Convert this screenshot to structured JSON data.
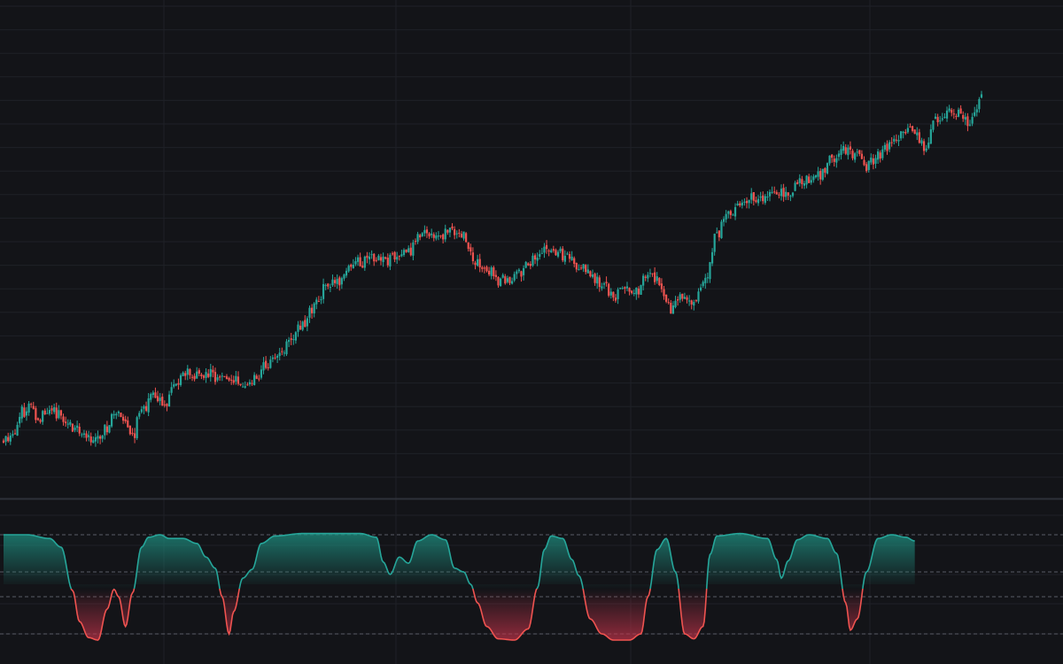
{
  "colors": {
    "background": "#131418",
    "grid": "#1f2127",
    "separator": "#2e3139",
    "up": "#26a69a",
    "down": "#ef5350",
    "up_fill_top": "#1e8c7e",
    "down_fill_bottom": "#c2334a",
    "level_line": "#5a5d66"
  },
  "chart_data": [
    {
      "type": "candlestick",
      "name": "",
      "x": {
        "range": [
          0,
          425
        ]
      },
      "ylim": [
        0,
        212
      ],
      "grid": true,
      "anchors": [
        [
          0,
          12
        ],
        [
          4,
          16
        ],
        [
          8,
          28
        ],
        [
          12,
          32
        ],
        [
          15,
          25
        ],
        [
          20,
          31
        ],
        [
          24,
          26
        ],
        [
          28,
          21
        ],
        [
          34,
          16
        ],
        [
          40,
          11
        ],
        [
          44,
          18
        ],
        [
          48,
          28
        ],
        [
          52,
          22
        ],
        [
          56,
          14
        ],
        [
          60,
          30
        ],
        [
          65,
          36
        ],
        [
          70,
          32
        ],
        [
          75,
          44
        ],
        [
          80,
          52
        ],
        [
          85,
          49
        ],
        [
          90,
          50
        ],
        [
          95,
          47
        ],
        [
          100,
          46
        ],
        [
          105,
          44
        ],
        [
          110,
          50
        ],
        [
          115,
          56
        ],
        [
          120,
          62
        ],
        [
          125,
          73
        ],
        [
          130,
          78
        ],
        [
          135,
          90
        ],
        [
          140,
          100
        ],
        [
          145,
          103
        ],
        [
          150,
          111
        ],
        [
          155,
          115
        ],
        [
          160,
          118
        ],
        [
          165,
          116
        ],
        [
          170,
          117
        ],
        [
          175,
          119
        ],
        [
          180,
          129
        ],
        [
          185,
          132
        ],
        [
          190,
          131
        ],
        [
          195,
          134
        ],
        [
          200,
          130
        ],
        [
          205,
          114
        ],
        [
          210,
          111
        ],
        [
          215,
          105
        ],
        [
          220,
          104
        ],
        [
          225,
          110
        ],
        [
          230,
          116
        ],
        [
          235,
          123
        ],
        [
          240,
          121
        ],
        [
          245,
          117
        ],
        [
          250,
          114
        ],
        [
          255,
          107
        ],
        [
          260,
          102
        ],
        [
          265,
          95
        ],
        [
          270,
          103
        ],
        [
          275,
          98
        ],
        [
          280,
          109
        ],
        [
          285,
          104
        ],
        [
          290,
          87
        ],
        [
          295,
          94
        ],
        [
          300,
          92
        ],
        [
          305,
          107
        ],
        [
          310,
          132
        ],
        [
          315,
          143
        ],
        [
          320,
          150
        ],
        [
          325,
          154
        ],
        [
          330,
          152
        ],
        [
          335,
          156
        ],
        [
          340,
          154
        ],
        [
          345,
          161
        ],
        [
          350,
          163
        ],
        [
          355,
          165
        ],
        [
          360,
          176
        ],
        [
          365,
          182
        ],
        [
          370,
          177
        ],
        [
          375,
          170
        ],
        [
          380,
          178
        ],
        [
          385,
          182
        ],
        [
          390,
          190
        ],
        [
          395,
          192
        ],
        [
          400,
          183
        ],
        [
          405,
          197
        ],
        [
          410,
          201
        ],
        [
          415,
          203
        ],
        [
          420,
          197
        ],
        [
          425,
          210
        ]
      ]
    },
    {
      "type": "area",
      "name": "",
      "x": {
        "range": [
          0,
          425
        ]
      },
      "ylim": [
        0,
        100
      ],
      "levels": [
        90,
        60,
        40,
        10
      ],
      "anchors": [
        [
          0,
          90
        ],
        [
          10,
          90
        ],
        [
          20,
          87
        ],
        [
          25,
          80
        ],
        [
          30,
          45
        ],
        [
          33,
          20
        ],
        [
          37,
          7
        ],
        [
          41,
          5
        ],
        [
          45,
          30
        ],
        [
          48,
          46
        ],
        [
          50,
          40
        ],
        [
          53,
          16
        ],
        [
          56,
          43
        ],
        [
          60,
          80
        ],
        [
          63,
          88
        ],
        [
          68,
          90
        ],
        [
          72,
          87
        ],
        [
          78,
          87
        ],
        [
          84,
          83
        ],
        [
          88,
          72
        ],
        [
          92,
          63
        ],
        [
          95,
          40
        ],
        [
          98,
          10
        ],
        [
          100,
          28
        ],
        [
          104,
          55
        ],
        [
          108,
          62
        ],
        [
          112,
          83
        ],
        [
          118,
          89
        ],
        [
          130,
          91
        ],
        [
          140,
          91
        ],
        [
          155,
          91
        ],
        [
          162,
          88
        ],
        [
          165,
          68
        ],
        [
          168,
          58
        ],
        [
          172,
          72
        ],
        [
          176,
          67
        ],
        [
          180,
          85
        ],
        [
          186,
          90
        ],
        [
          192,
          86
        ],
        [
          196,
          63
        ],
        [
          200,
          60
        ],
        [
          203,
          50
        ],
        [
          206,
          35
        ],
        [
          210,
          16
        ],
        [
          215,
          6
        ],
        [
          222,
          5
        ],
        [
          228,
          14
        ],
        [
          232,
          47
        ],
        [
          235,
          78
        ],
        [
          238,
          89
        ],
        [
          243,
          87
        ],
        [
          247,
          70
        ],
        [
          250,
          57
        ],
        [
          255,
          22
        ],
        [
          260,
          10
        ],
        [
          265,
          5
        ],
        [
          272,
          5
        ],
        [
          277,
          10
        ],
        [
          280,
          40
        ],
        [
          284,
          78
        ],
        [
          288,
          87
        ],
        [
          292,
          60
        ],
        [
          296,
          10
        ],
        [
          300,
          6
        ],
        [
          304,
          16
        ],
        [
          307,
          74
        ],
        [
          310,
          89
        ],
        [
          320,
          91
        ],
        [
          332,
          87
        ],
        [
          336,
          70
        ],
        [
          338,
          55
        ],
        [
          341,
          69
        ],
        [
          345,
          86
        ],
        [
          350,
          90
        ],
        [
          358,
          87
        ],
        [
          362,
          75
        ],
        [
          366,
          35
        ],
        [
          368,
          13
        ],
        [
          371,
          22
        ],
        [
          375,
          60
        ],
        [
          380,
          87
        ],
        [
          386,
          90
        ],
        [
          392,
          88
        ],
        [
          396,
          85
        ]
      ]
    }
  ]
}
